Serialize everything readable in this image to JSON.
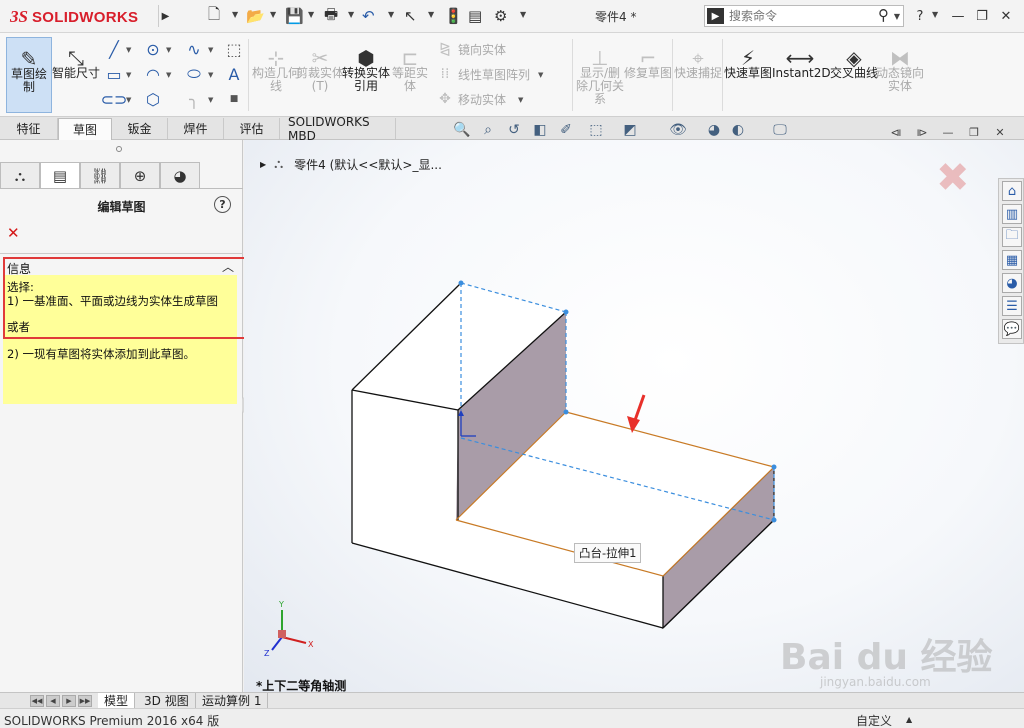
{
  "app": {
    "logo_ds": "3S",
    "logo_text": "SOLIDWORKS",
    "doc_title": "零件4 *",
    "search_placeholder": "搜索命令",
    "help_label": "?",
    "colors": {
      "brand": "#d81e2b",
      "accent": "#2a5ca8",
      "info_bg": "#ffff99",
      "alert": "#e03a3a"
    }
  },
  "ribbon": {
    "sketch_btn": "草图绘制",
    "smart_dim": "智能尺寸",
    "convert_geom": "构造几何线",
    "trim": "剪裁实体(T)",
    "convert_entities": "转换实体引用",
    "offset": "等距实体",
    "mirror": "镜向实体",
    "linear_pattern": "线性草图阵列",
    "move": "移动实体",
    "display_relations": "显示/删除几何关系",
    "repair": "修复草图",
    "quick_snap": "快速捕捉",
    "rapid_sketch": "快速草图",
    "instant2d": "Instant2D",
    "intersection": "交叉曲线",
    "dynamic_mirror": "动态镜向实体"
  },
  "tabs": [
    "特征",
    "草图",
    "钣金",
    "焊件",
    "评估",
    "SOLIDWORKS MBD"
  ],
  "panel": {
    "title": "编辑草图",
    "info_header": "信息",
    "info_lines": [
      "选择:",
      "1) 一基准面、平面或边线为实体生成草图",
      "或者",
      "2) 一现有草图将实体添加到此草图。"
    ]
  },
  "graphics": {
    "tree_node": "零件4  (默认<<默认>_显...",
    "feature_tooltip": "凸台-拉伸1",
    "view_name": "*上下二等角轴测",
    "axis_labels": {
      "x": "X",
      "y": "Y",
      "z": "Z"
    }
  },
  "bottom_tabs": [
    "模型",
    "3D 视图",
    "运动算例 1"
  ],
  "status": {
    "product": "SOLIDWORKS Premium 2016 x64 版",
    "units": "自定义"
  },
  "watermark": {
    "main": "Bai du 经验",
    "sub": "jingyan.baidu.com"
  }
}
